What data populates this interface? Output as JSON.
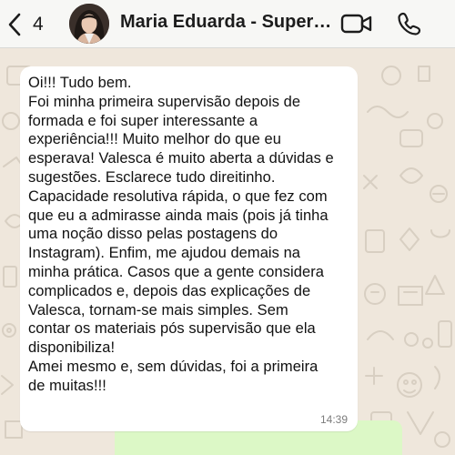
{
  "header": {
    "back_count": "4",
    "contact_name": "Maria Eduarda - Superv...",
    "icons": {
      "back": "chevron-left-icon",
      "video": "video-camera-icon",
      "call": "phone-icon"
    },
    "accent_color": "#111111"
  },
  "chat": {
    "background_color": "#efe7dc",
    "message": {
      "lines": [
        "Oi!!! Tudo bem.",
        "Foi minha primeira supervisão depois de",
        "formada e foi super interessante a",
        "experiência!!! Muito melhor do que eu",
        "esperava! Valesca é muito aberta a dúvidas e",
        "sugestões. Esclarece tudo direitinho.",
        "Capacidade resolutiva rápida, o que fez com",
        "que eu a admirasse ainda mais (pois já tinha",
        "uma noção disso pelas postagens do",
        "Instagram). Enfim, me ajudou demais na",
        "minha prática. Casos que a gente considera",
        "complicados e, depois das explicações de",
        "Valesca, tornam-se mais simples. Sem",
        "contar os materiais pós supervisão que ela",
        "disponibiliza!",
        "Amei mesmo e, sem dúvidas, foi a primeira",
        "de muitas!!!"
      ],
      "time": "14:39",
      "bubble_color": "#ffffff"
    },
    "outgoing_bubble_color": "#dcf8c6"
  }
}
